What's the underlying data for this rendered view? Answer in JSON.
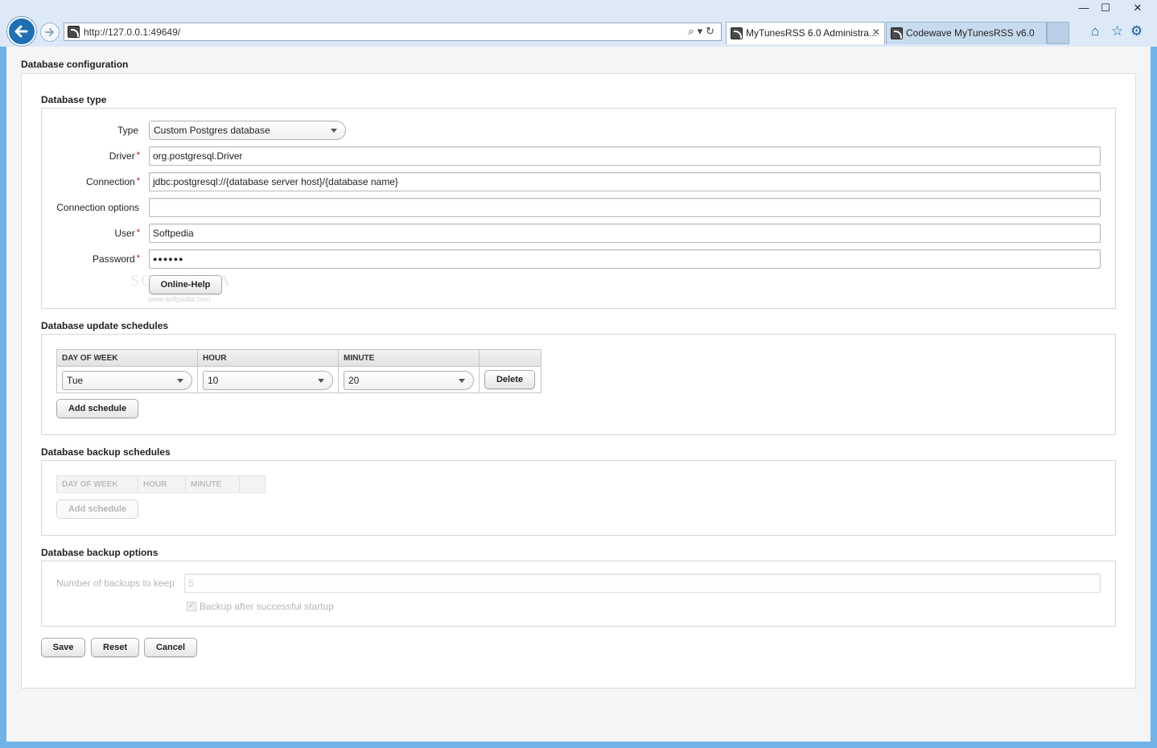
{
  "browser": {
    "url": "http://127.0.0.1:49649/",
    "tabs": [
      {
        "label": "MyTunesRSS 6.0 Administra...",
        "active": true
      },
      {
        "label": "Codewave MyTunesRSS v6.0",
        "active": false
      }
    ],
    "window_controls": {
      "minimize": "—",
      "maximize": "☐",
      "close": "✕"
    }
  },
  "page": {
    "title": "Database configuration"
  },
  "database_type": {
    "section_title": "Database type",
    "type_label": "Type",
    "type_value": "Custom Postgres database",
    "driver_label": "Driver",
    "driver_value": "org.postgresql.Driver",
    "connection_label": "Connection",
    "connection_value": "jdbc:postgresql://{database server host}/{database name}",
    "connection_options_label": "Connection options",
    "connection_options_value": "",
    "user_label": "User",
    "user_value": "Softpedia",
    "password_label": "Password",
    "password_value": "●●●●●●",
    "required_marker": "*",
    "online_help_label": "Online-Help",
    "watermark": "SOFTPEDIA",
    "watermark_url": "www.softpedia.com"
  },
  "update_schedules": {
    "section_title": "Database update schedules",
    "columns": [
      "DAY OF WEEK",
      "HOUR",
      "MINUTE",
      ""
    ],
    "rows": [
      {
        "day": "Tue",
        "hour": "10",
        "minute": "20",
        "delete_label": "Delete"
      }
    ],
    "add_label": "Add schedule"
  },
  "backup_schedules": {
    "section_title": "Database backup schedules",
    "columns": [
      "DAY OF WEEK",
      "HOUR",
      "MINUTE",
      ""
    ],
    "add_label": "Add schedule"
  },
  "backup_options": {
    "section_title": "Database backup options",
    "keep_label": "Number of backups to keep",
    "keep_value": "5",
    "startup_label": "Backup after successful startup",
    "startup_checked": true
  },
  "actions": {
    "save": "Save",
    "reset": "Reset",
    "cancel": "Cancel"
  }
}
